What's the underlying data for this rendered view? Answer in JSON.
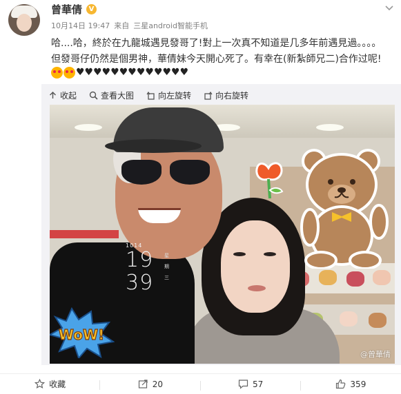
{
  "post": {
    "author_name": "曾華倩",
    "verified_badge": "V",
    "timestamp": "10月14日 19:47",
    "source_prefix": "来自",
    "source_device": "三星android智能手机",
    "text_lines": [
      "哈....哈，終於在九龍城遇見發哥了!對上一次真不知道是几多年前遇見過。。。。",
      "但發哥仔仍然是個男神，華倩妹今天開心死了。有幸在(新紮師兄二)合作过呢!"
    ],
    "emoji_names": [
      "hearts-face-emoji",
      "smiling-face-emoji"
    ],
    "hearts": "♥♥♥♥♥♥♥♥♥♥♥♥♥"
  },
  "media_toolbar": {
    "collapse": "收起",
    "view_large": "查看大图",
    "rotate_left": "向左旋转",
    "rotate_right": "向右旋转"
  },
  "photo": {
    "clock_date": "1014",
    "clock_hour": "19",
    "clock_minute": "39",
    "clock_weekday": "星",
    "clock_weekday2": "期",
    "clock_weekday3": "三",
    "sticker_text": "WoW!",
    "watermark": "@曾華倩"
  },
  "actions": {
    "favorite_label": "收藏",
    "repost_count": "20",
    "comment_count": "57",
    "like_count": "359"
  },
  "colors": {
    "accent_orange": "#f7b731",
    "text_primary": "#333333",
    "text_meta": "#808080",
    "toolbar_bg": "#f2f2f5"
  }
}
